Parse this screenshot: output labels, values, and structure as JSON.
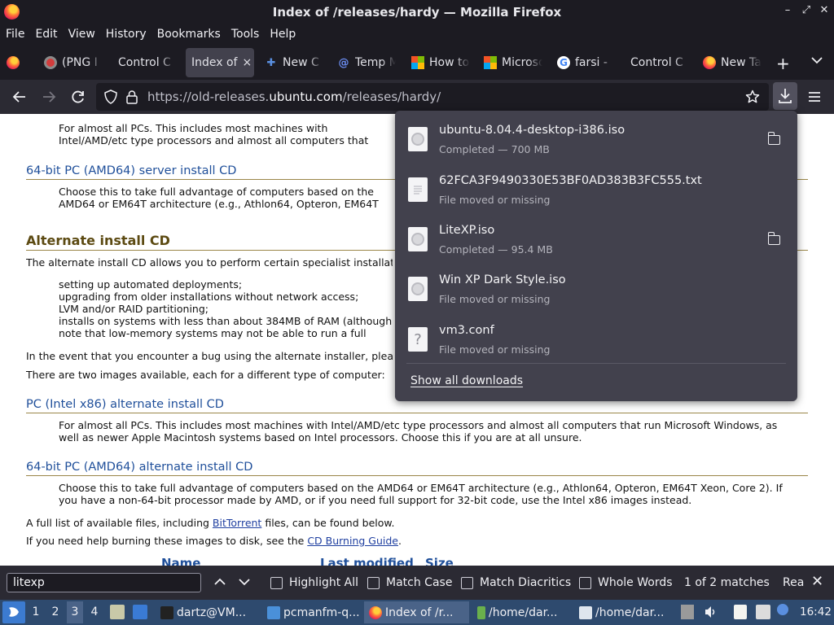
{
  "window": {
    "title": "Index of /releases/hardy — Mozilla Firefox",
    "controls": [
      "–",
      "⤢",
      "✕"
    ]
  },
  "menu": [
    "File",
    "Edit",
    "View",
    "History",
    "Bookmarks",
    "Tools",
    "Help"
  ],
  "tabs": [
    {
      "label": "",
      "icon": "firefox-icon"
    },
    {
      "label": "(PNG I",
      "icon": "png-icon"
    },
    {
      "label": "Control C",
      "icon": ""
    },
    {
      "label": "Index of",
      "icon": "",
      "active": true,
      "close": "×"
    },
    {
      "label": "New C",
      "icon": "puzzle-icon"
    },
    {
      "label": "Temp M",
      "icon": "at-icon"
    },
    {
      "label": "How to",
      "icon": "windows-icon"
    },
    {
      "label": "Microso",
      "icon": "windows-icon"
    },
    {
      "label": "farsi - ",
      "icon": "google-icon"
    },
    {
      "label": "Control C",
      "icon": ""
    },
    {
      "label": "New Ta",
      "icon": "firefox-icon"
    }
  ],
  "tab_actions": {
    "new_tab": "+",
    "all_tabs": "⌄"
  },
  "url": {
    "prefix": "https://old-releases.",
    "domain": "ubuntu.com",
    "path": "/releases/hardy/"
  },
  "page": {
    "desc1": "For almost all PCs. This includes most machines with Intel/AMD/etc type processors and almost all computers that run Microsoft Windows, as well as newer Apple Macintosh systems based on Intel processors. Choose this if you are at all unsure.",
    "h_server64": "64-bit PC (AMD64) server install CD",
    "desc_server64": "Choose this to take full advantage of computers based on the AMD64 or EM64T architecture (e.g., Athlon64, Opteron, EM64T Xeon, Core 2). If you have a non-64-bit processor made by AMD, or if you need full support for 32-bit code, use the Intel x86 images instead.",
    "h_alternate": "Alternate install CD",
    "alt_intro": "The alternate install CD allows you to perform certain specialist installations of Ubuntu. It provides for:",
    "alt_list": [
      "setting up automated deployments;",
      "upgrading from older installations without network access;",
      "LVM and/or RAID partitioning;",
      "installs on systems with less than about 384MB of RAM (although note that low-memory systems may not be able to run a full desktop environment reasonably)."
    ],
    "bug_note": "In the event that you encounter a bug using the alternate installer, please file a bug on the debian-installer package.",
    "two_images": "There are two images available, each for a different type of computer:",
    "h_pc_alt": "PC (Intel x86) alternate install CD",
    "desc_pc_alt": "For almost all PCs. This includes most machines with Intel/AMD/etc type processors and almost all computers that run Microsoft Windows, as well as newer Apple Macintosh systems based on Intel processors. Choose this if you are at all unsure.",
    "h_amd_alt": "64-bit PC (AMD64) alternate install CD",
    "desc_amd_alt": "Choose this to take full advantage of computers based on the AMD64 or EM64T architecture (e.g., Athlon64, Opteron, EM64T Xeon, Core 2). If you have a non-64-bit processor made by AMD, or if you need full support for 32-bit code, use the Intel x86 images instead.",
    "full_list_pre": "A full list of available files, including ",
    "full_list_link": "BitTorrent",
    "full_list_post": " files, can be found below.",
    "burn_pre": "If you need help burning these images to disk, see the ",
    "burn_link": "CD Burning Guide",
    "burn_post": ".",
    "col_name": "Name",
    "col_modified": "Last modified",
    "col_size": "Size"
  },
  "downloads": {
    "items": [
      {
        "name": "ubuntu-8.04.4-desktop-i386.iso",
        "status": "Completed — 700 MB",
        "kind": "iso",
        "folder": true
      },
      {
        "name": "62FCA3F9490330E53BF0AD383B3FC555.txt",
        "status": "File moved or missing",
        "kind": "txt",
        "folder": false
      },
      {
        "name": "LiteXP.iso",
        "status": "Completed — 95.4 MB",
        "kind": "iso",
        "folder": true
      },
      {
        "name": "Win XP Dark Style.iso",
        "status": "File moved or missing",
        "kind": "iso",
        "folder": false
      },
      {
        "name": "vm3.conf",
        "status": "File moved or missing",
        "kind": "unknown",
        "folder": false
      }
    ],
    "show_all": "Show all downloads"
  },
  "findbar": {
    "query": "litexp",
    "highlight_all": "Highlight All",
    "match_case": "Match Case",
    "match_diacritics": "Match Diacritics",
    "whole_words": "Whole Words",
    "status": "1 of 2 matches",
    "extra": "Rea",
    "close": "✕"
  },
  "taskbar": {
    "workspaces": [
      "1",
      "2",
      "3",
      "4"
    ],
    "active_workspace": "3",
    "tasks": [
      {
        "label": "dartz@VM..."
      },
      {
        "label": "pcmanfm-q..."
      },
      {
        "label": "Index of /r..."
      },
      {
        "label": "/home/dar..."
      },
      {
        "label": "/home/dar..."
      }
    ],
    "clock": "16:42"
  }
}
